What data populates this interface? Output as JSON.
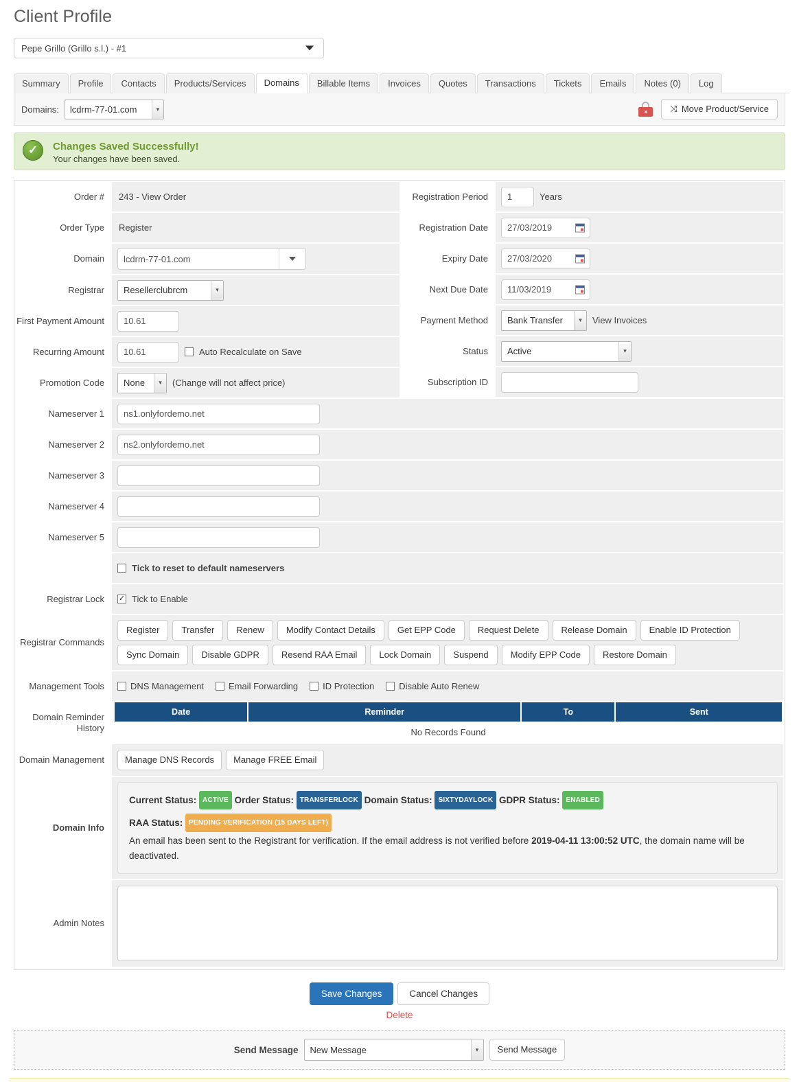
{
  "page": {
    "title": "Client Profile"
  },
  "client_selector": {
    "value": "Pepe Grillo (Grillo s.l.) - #1"
  },
  "tabs": [
    {
      "label": "Summary",
      "active": false
    },
    {
      "label": "Profile",
      "active": false
    },
    {
      "label": "Contacts",
      "active": false
    },
    {
      "label": "Products/Services",
      "active": false
    },
    {
      "label": "Domains",
      "active": true
    },
    {
      "label": "Billable Items",
      "active": false
    },
    {
      "label": "Invoices",
      "active": false
    },
    {
      "label": "Quotes",
      "active": false
    },
    {
      "label": "Transactions",
      "active": false
    },
    {
      "label": "Tickets",
      "active": false
    },
    {
      "label": "Emails",
      "active": false
    },
    {
      "label": "Notes (0)",
      "active": false
    },
    {
      "label": "Log",
      "active": false
    }
  ],
  "domains_bar": {
    "label": "Domains:",
    "selected_domain": "lcdrm-77-01.com",
    "lock_icon": "red-lock-x-icon",
    "move_button": "Move Product/Service",
    "move_icon": "shuffle-icon"
  },
  "alert": {
    "icon": "success-check-icon",
    "title": "Changes Saved Successfully!",
    "text": "Your changes have been saved."
  },
  "form": {
    "left": {
      "order_number_label": "Order #",
      "order_number_value": "243 - View Order",
      "order_type_label": "Order Type",
      "order_type_value": "Register",
      "domain_label": "Domain",
      "domain_value": "lcdrm-77-01.com",
      "registrar_label": "Registrar",
      "registrar_value": "Resellerclubrcm",
      "first_payment_label": "First Payment Amount",
      "first_payment_value": "10.61",
      "recurring_label": "Recurring Amount",
      "recurring_value": "10.61",
      "auto_recalc_label": "Auto Recalculate on Save",
      "auto_recalc_checked": false,
      "promotion_label": "Promotion Code",
      "promotion_value": "None",
      "promotion_note": "(Change will not affect price)"
    },
    "right": {
      "registration_period_label": "Registration Period",
      "registration_period_value": "1",
      "registration_period_unit": "Years",
      "registration_date_label": "Registration Date",
      "registration_date_value": "27/03/2019",
      "expiry_date_label": "Expiry Date",
      "expiry_date_value": "27/03/2020",
      "next_due_date_label": "Next Due Date",
      "next_due_date_value": "11/03/2019",
      "payment_method_label": "Payment Method",
      "payment_method_value": "Bank Transfer",
      "view_invoices_link": "View Invoices",
      "status_label": "Status",
      "status_value": "Active",
      "subscription_id_label": "Subscription ID",
      "subscription_id_value": ""
    },
    "nameservers": [
      {
        "label": "Nameserver 1",
        "value": "ns1.onlyfordemo.net"
      },
      {
        "label": "Nameserver 2",
        "value": "ns2.onlyfordemo.net"
      },
      {
        "label": "Nameserver 3",
        "value": ""
      },
      {
        "label": "Nameserver 4",
        "value": ""
      },
      {
        "label": "Nameserver 5",
        "value": ""
      }
    ],
    "reset_ns_label": "Tick to reset to default nameservers",
    "reset_ns_checked": false,
    "registrar_lock_label": "Registrar Lock",
    "registrar_lock_tick_label": "Tick to Enable",
    "registrar_lock_checked": true,
    "registrar_commands_label": "Registrar Commands",
    "registrar_commands": [
      "Register",
      "Transfer",
      "Renew",
      "Modify Contact Details",
      "Get EPP Code",
      "Request Delete",
      "Release Domain",
      "Enable ID Protection",
      "Sync Domain",
      "Disable GDPR",
      "Resend RAA Email",
      "Lock Domain",
      "Suspend",
      "Modify EPP Code",
      "Restore Domain"
    ],
    "management_tools_label": "Management Tools",
    "management_tools": [
      {
        "label": "DNS Management",
        "checked": false
      },
      {
        "label": "Email Forwarding",
        "checked": false
      },
      {
        "label": "ID Protection",
        "checked": false
      },
      {
        "label": "Disable Auto Renew",
        "checked": false
      }
    ],
    "reminder_history_label": "Domain Reminder History",
    "reminder_table": {
      "columns": [
        "Date",
        "Reminder",
        "To",
        "Sent"
      ],
      "rows": [],
      "empty_text": "No Records Found"
    },
    "domain_management_label": "Domain Management",
    "domain_management_buttons": [
      "Manage DNS Records",
      "Manage FREE Email"
    ],
    "domain_info_label": "Domain Info",
    "domain_info": {
      "current_status_label": "Current Status:",
      "current_status_badge": "ACTIVE",
      "order_status_label": "Order Status:",
      "order_status_badge": "TRANSFERLOCK",
      "domain_status_label": "Domain Status:",
      "domain_status_badge": "SIXTYDAYLOCK",
      "gdpr_status_label": "GDPR Status:",
      "gdpr_status_badge": "ENABLED",
      "raa_status_label": "RAA Status:",
      "raa_status_badge": "PENDING VERIFICATION (15 DAYS LEFT)",
      "raa_text_before": "An email has been sent to the Registrant for verification. If the email address is not verified before",
      "raa_deadline": "2019-04-11 13:00:52 UTC",
      "raa_text_after": ", the domain name will be deactivated."
    },
    "admin_notes_label": "Admin Notes",
    "admin_notes_value": ""
  },
  "actions": {
    "save_label": "Save Changes",
    "cancel_label": "Cancel Changes",
    "delete_label": "Delete"
  },
  "send_message": {
    "label": "Send Message",
    "selected": "New Message",
    "button": "Send Message"
  },
  "colors": {
    "primary_blue": "#2b74b8",
    "table_header_blue": "#1a4f81",
    "badge_green": "#5cb85c",
    "badge_blue": "#2a6496",
    "badge_orange": "#f0ad4e",
    "delete_red": "#d9534f",
    "alert_green_bg": "#e3efd2",
    "alert_green_text": "#6f9b2e"
  }
}
